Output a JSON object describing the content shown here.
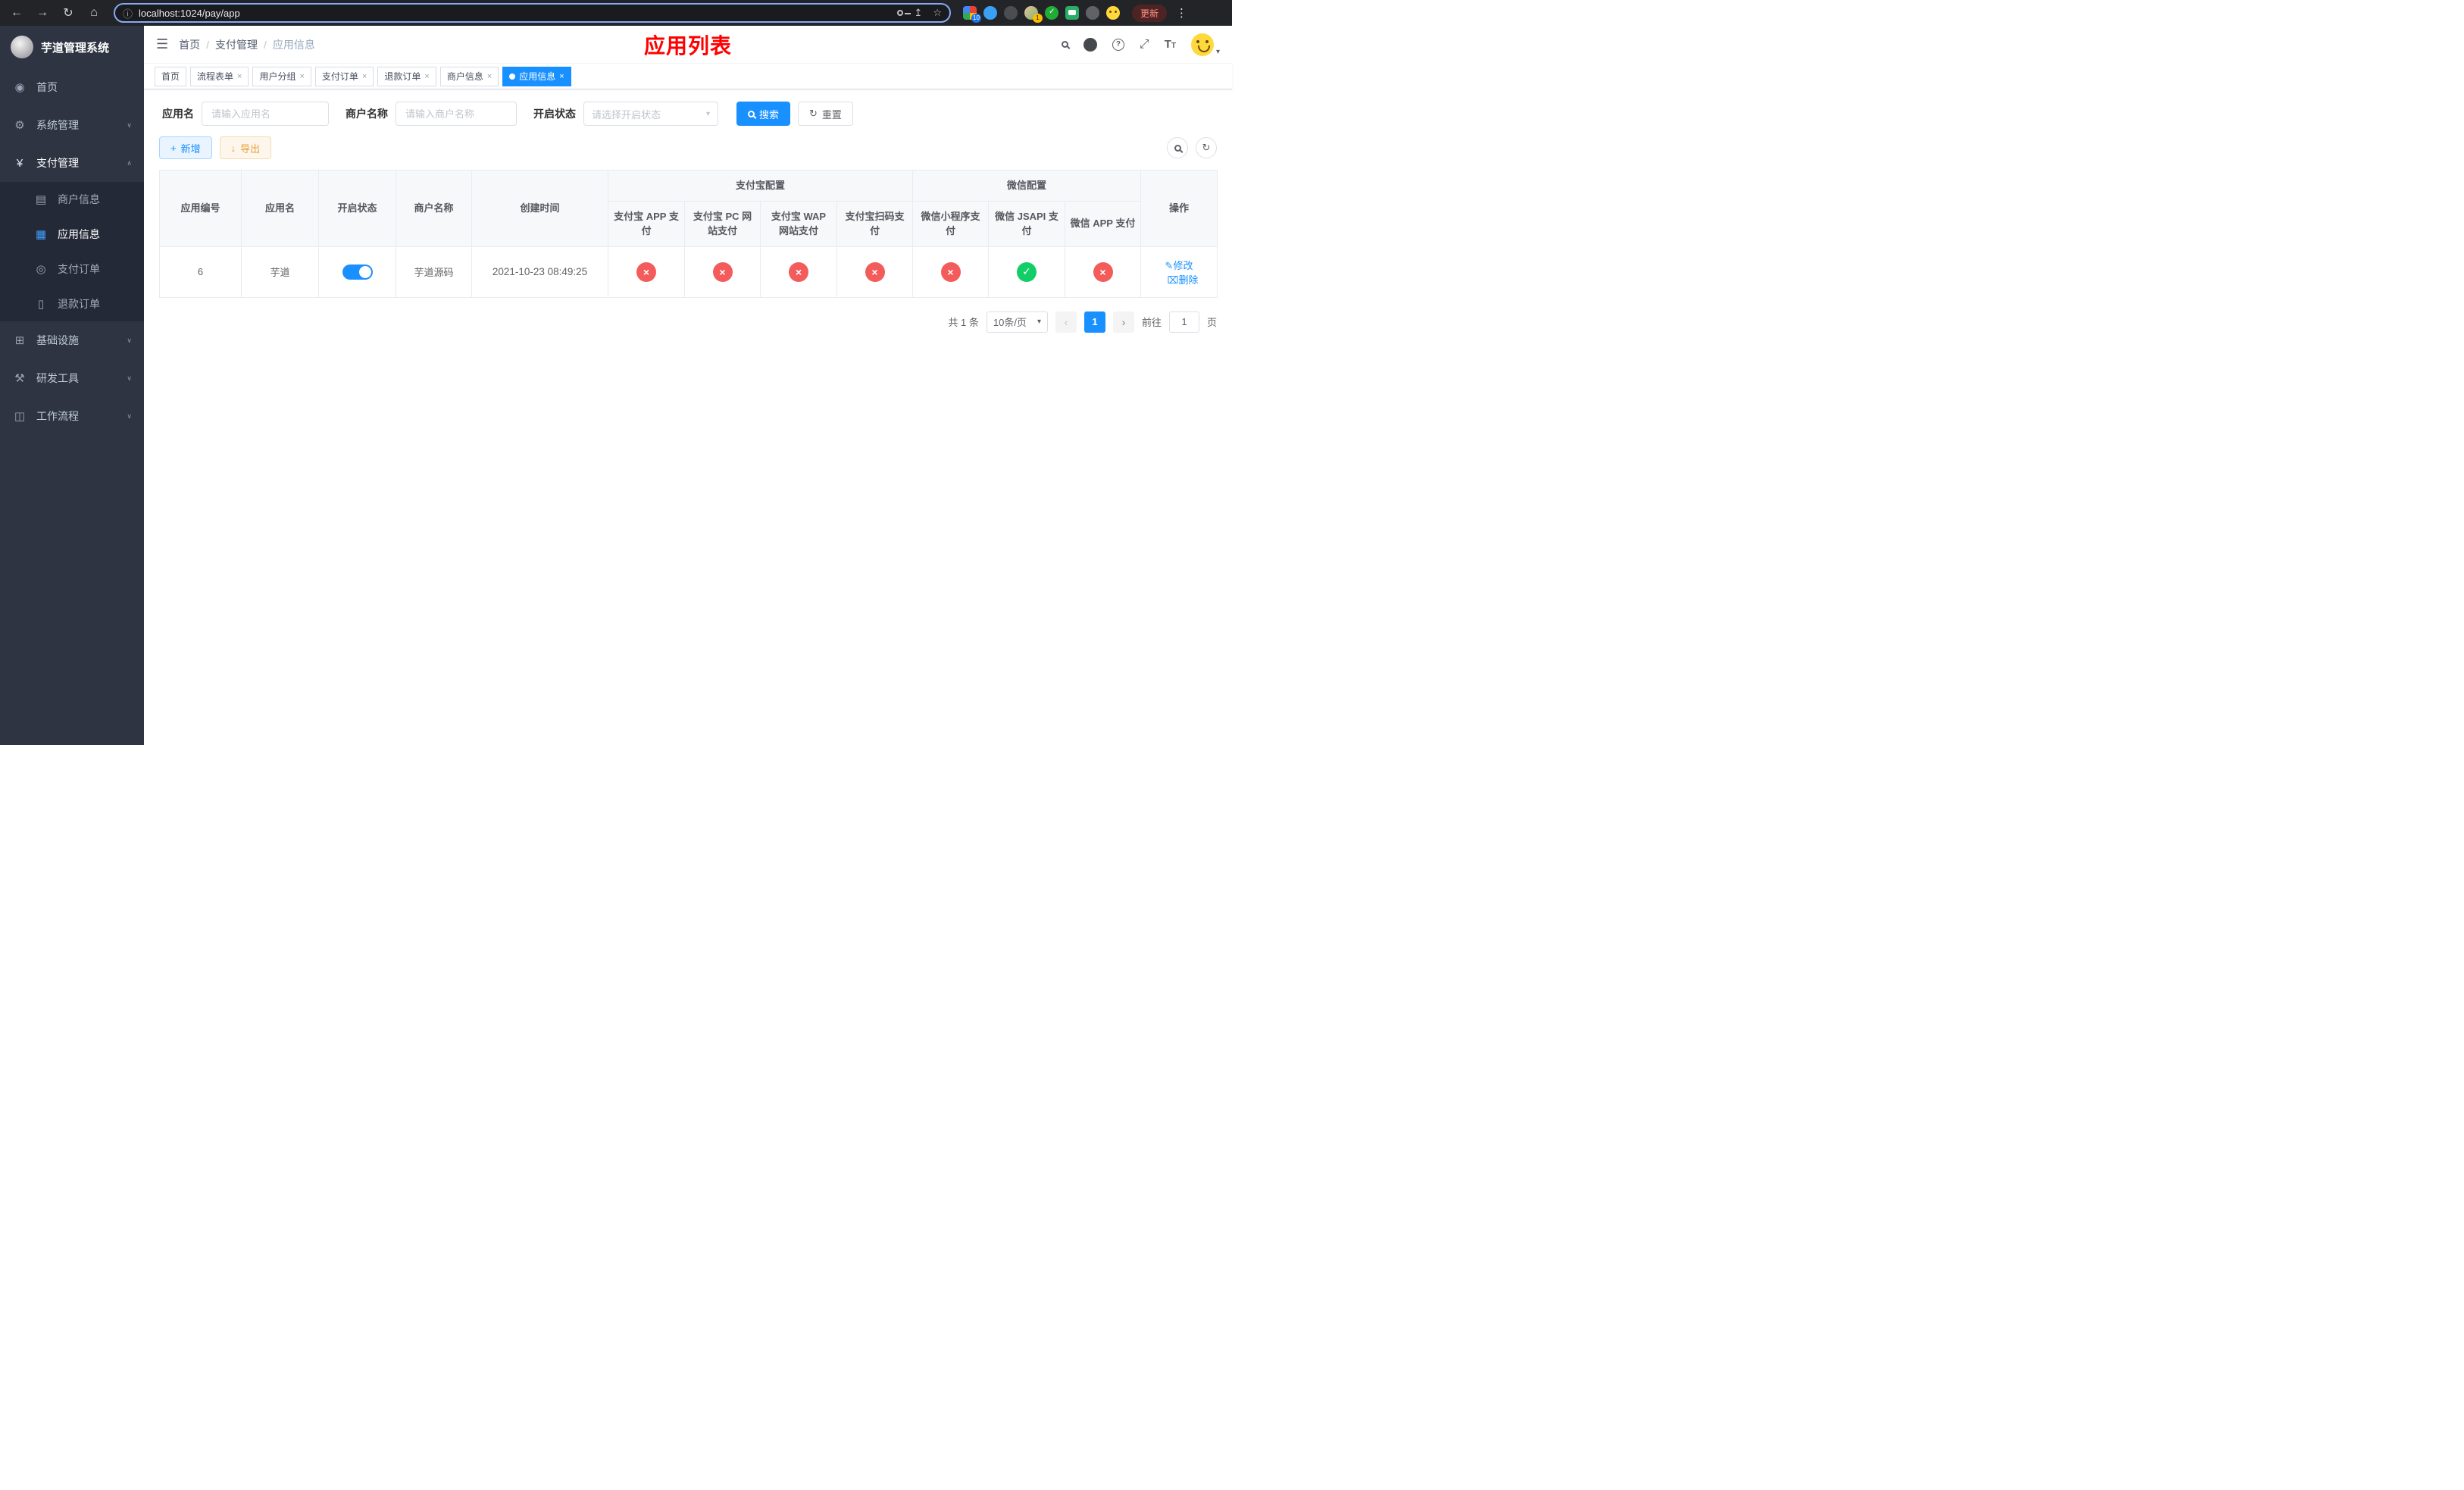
{
  "browser": {
    "url": "localhost:1024/pay/app",
    "update_button": "更新",
    "extension_badges": {
      "blocks": "10",
      "avatar": "1"
    }
  },
  "sidebar": {
    "title": "芋道管理系统",
    "home": "首页",
    "system": "系统管理",
    "payment": "支付管理",
    "merchant_info": "商户信息",
    "app_info": "应用信息",
    "pay_order": "支付订单",
    "refund_order": "退款订单",
    "infrastructure": "基础设施",
    "dev_tools": "研发工具",
    "workflow": "工作流程"
  },
  "topbar": {
    "breadcrumb": {
      "home": "首页",
      "section": "支付管理",
      "current": "应用信息"
    },
    "page_title": "应用列表"
  },
  "tabs": [
    {
      "label": "首页"
    },
    {
      "label": "流程表单"
    },
    {
      "label": "用户分组"
    },
    {
      "label": "支付订单"
    },
    {
      "label": "退款订单"
    },
    {
      "label": "商户信息"
    },
    {
      "label": "应用信息"
    }
  ],
  "filters": {
    "app_name_label": "应用名",
    "app_name_placeholder": "请输入应用名",
    "merchant_label": "商户名称",
    "merchant_placeholder": "请输入商户名称",
    "status_label": "开启状态",
    "status_placeholder": "请选择开启状态",
    "search_button": "搜索",
    "reset_button": "重置"
  },
  "toolbar": {
    "add_button": "新增",
    "export_button": "导出"
  },
  "table": {
    "headers": {
      "app_id": "应用编号",
      "app_name": "应用名",
      "status": "开启状态",
      "merchant": "商户名称",
      "create_time": "创建时间",
      "alipay_group": "支付宝配置",
      "alipay_app": "支付宝 APP 支付",
      "alipay_pc": "支付宝 PC 网站支付",
      "alipay_wap": "支付宝 WAP 网站支付",
      "alipay_qr": "支付宝扫码支付",
      "wechat_group": "微信配置",
      "wechat_mini": "微信小程序支付",
      "wechat_jsapi": "微信 JSAPI 支付",
      "wechat_app": "微信 APP 支付",
      "actions": "操作"
    },
    "row": {
      "app_id": "6",
      "app_name": "芋道",
      "merchant": "芋道源码",
      "create_time": "2021-10-23 08:49:25",
      "edit_label": "修改",
      "delete_label": "删除",
      "statuses": {
        "enabled": "open",
        "alipay_app": "closed",
        "alipay_pc": "closed",
        "alipay_wap": "closed",
        "alipay_qr": "closed",
        "wechat_mini": "closed",
        "wechat_jsapi": "open",
        "wechat_app": "closed"
      }
    }
  },
  "pagination": {
    "total_text": "共 1 条",
    "page_size": "10条/页",
    "current_page": "1",
    "goto_prefix": "前往",
    "goto_value": "1",
    "goto_suffix": "页"
  },
  "colors": {
    "accent": "#1890ff",
    "danger": "#f45b5b",
    "success": "#13ce66",
    "warning": "#e6a23c",
    "page_title": "#ff0000",
    "sidebar_bg": "#2f3442"
  }
}
